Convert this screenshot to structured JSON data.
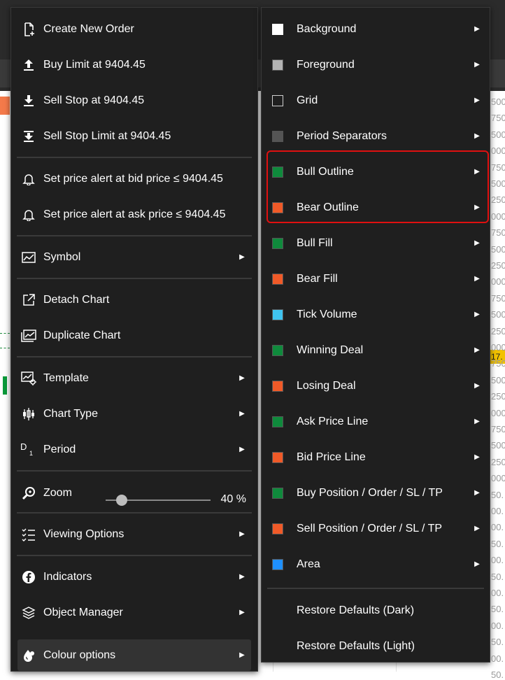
{
  "context_menu": {
    "items": [
      {
        "label": "Create New Order",
        "icon": "new-order-icon"
      },
      {
        "label": "Buy Limit at 9404.45",
        "icon": "upload-arrow-icon"
      },
      {
        "label": "Sell Stop at 9404.45",
        "icon": "download-arrow-icon"
      },
      {
        "label": "Sell Stop Limit at 9404.45",
        "icon": "download-bar-icon"
      },
      {
        "label": "Set price alert at bid price ≤ 9404.45",
        "icon": "bell-icon"
      },
      {
        "label": "Set price alert at ask price ≤ 9404.45",
        "icon": "bell-icon"
      },
      {
        "label": "Symbol",
        "icon": "symbol-chart-icon"
      },
      {
        "label": "Detach Chart",
        "icon": "external-link-icon"
      },
      {
        "label": "Duplicate Chart",
        "icon": "duplicate-chart-icon"
      },
      {
        "label": "Template",
        "icon": "template-icon"
      },
      {
        "label": "Chart Type",
        "icon": "candlestick-icon"
      },
      {
        "label": "Period",
        "icon": "period-icon",
        "icon_text": "D",
        "icon_sub": "1"
      },
      {
        "label": "Zoom",
        "icon": "zoom-icon"
      },
      {
        "label": "Viewing Options",
        "icon": "checklist-icon"
      },
      {
        "label": "Indicators",
        "icon": "indicators-icon"
      },
      {
        "label": "Object Manager",
        "icon": "layers-icon"
      },
      {
        "label": "Colour options",
        "icon": "colour-drop-icon"
      }
    ],
    "zoom_value": "40 %",
    "zoom_level_percent": 40
  },
  "colour_submenu": {
    "items": [
      {
        "label": "Background",
        "color": "#ffffff"
      },
      {
        "label": "Foreground",
        "color": "#b3b3b3"
      },
      {
        "label": "Grid",
        "color": "#1f1f1f"
      },
      {
        "label": "Period Separators",
        "color": "#555555"
      },
      {
        "label": "Bull Outline",
        "color": "#0f8a3c"
      },
      {
        "label": "Bear Outline",
        "color": "#f05a28"
      },
      {
        "label": "Bull Fill",
        "color": "#0f8a3c"
      },
      {
        "label": "Bear Fill",
        "color": "#f05a28"
      },
      {
        "label": "Tick Volume",
        "color": "#3fc4f0"
      },
      {
        "label": "Winning Deal",
        "color": "#0f8a3c"
      },
      {
        "label": "Losing Deal",
        "color": "#f05a28"
      },
      {
        "label": "Ask Price Line",
        "color": "#0f8a3c"
      },
      {
        "label": "Bid Price Line",
        "color": "#f05a28"
      },
      {
        "label": "Buy Position / Order / SL / TP",
        "color": "#0f8a3c"
      },
      {
        "label": "Sell Position / Order / SL / TP",
        "color": "#f05a28"
      },
      {
        "label": "Area",
        "color": "#1e90ff"
      }
    ],
    "restore_dark": "Restore Defaults (Dark)",
    "restore_light": "Restore Defaults (Light)"
  },
  "price_scale": {
    "ticks": [
      "500",
      "750",
      "500",
      "000",
      "750",
      "500",
      "250",
      "000",
      "750",
      "500",
      "250",
      "000",
      "750",
      "500",
      "250",
      "000",
      "750",
      "500",
      "250",
      "000",
      "750",
      "500",
      "250",
      "000",
      "50.",
      "00.",
      "00.",
      "50.",
      "00.",
      "50.",
      "00.",
      "50.",
      "00.",
      "50.",
      "00.",
      "50."
    ],
    "current": "17."
  }
}
